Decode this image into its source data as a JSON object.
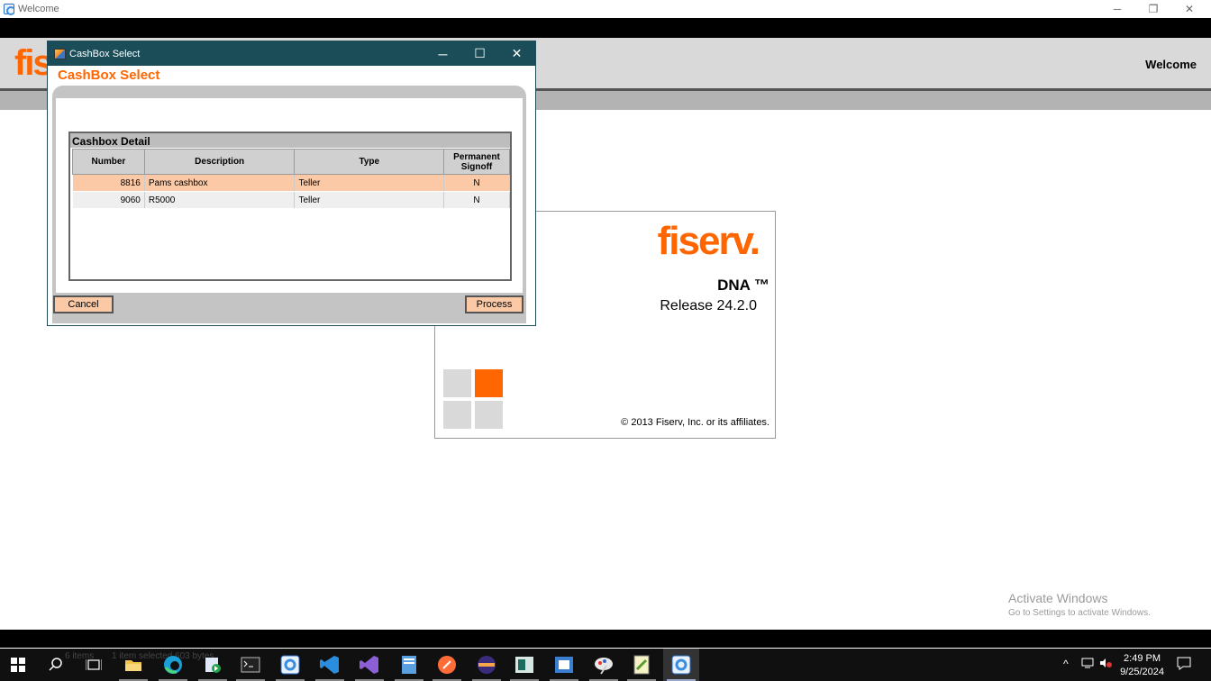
{
  "main_window": {
    "title": "Welcome",
    "minimize_glyph": "─",
    "restore_glyph": "❐",
    "close_glyph": "✕"
  },
  "header": {
    "logo_text": "fis",
    "welcome": "Welcome"
  },
  "splash": {
    "logo_text": "fiserv.",
    "product": "DNA ™",
    "release": "Release 24.2.0",
    "copyright": "© 2013 Fiserv, Inc. or its affiliates.",
    "accent_color": "#ff6600",
    "square_color": "#d9d9d9"
  },
  "dialog": {
    "window_title": "CashBox Select",
    "heading": "CashBox Select",
    "minimize_glyph": "─",
    "maximize_glyph": "☐",
    "close_glyph": "✕",
    "section_title": "Cashbox Detail",
    "columns": {
      "number": "Number",
      "description": "Description",
      "type": "Type",
      "permanent_signoff_1": "Permanent",
      "permanent_signoff_2": "Signoff"
    },
    "rows": [
      {
        "number": "8816",
        "description": "Pams cashbox",
        "type": "Teller",
        "permanent_signoff": "N",
        "selected": true
      },
      {
        "number": "9060",
        "description": "R5000",
        "type": "Teller",
        "permanent_signoff": "N",
        "selected": false
      }
    ],
    "cancel_label": "Cancel",
    "process_label": "Process",
    "selected_row_color": "#fcc9a6",
    "title_bar_color": "#1b4d59"
  },
  "watermark": {
    "line1": "Activate Windows",
    "line2": "Go to Settings to activate Windows."
  },
  "explorer_status": {
    "items": "6 items",
    "selected": "1 item selected  603 bytes"
  },
  "taskbar": {
    "apps": [
      "start-icon",
      "search-icon",
      "task-view-icon",
      "file-explorer-icon",
      "edge-icon",
      "store-icon",
      "terminal-icon",
      "dna-app-icon",
      "vscode-icon",
      "visual-studio-icon",
      "notepad-icon",
      "postman-icon",
      "eclipse-icon",
      "app-icon-1",
      "app-icon-2",
      "paint-icon",
      "notepadpp-icon",
      "dna-active-icon"
    ],
    "time": "2:49 PM",
    "date": "9/25/2024"
  }
}
